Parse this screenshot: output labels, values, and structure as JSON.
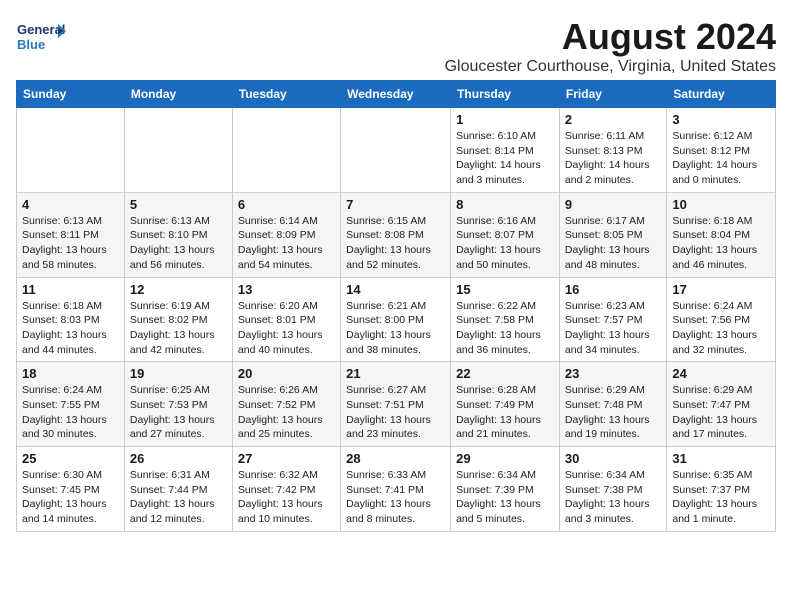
{
  "header": {
    "logo_general": "General",
    "logo_blue": "Blue",
    "title": "August 2024",
    "subtitle": "Gloucester Courthouse, Virginia, United States"
  },
  "days_of_week": [
    "Sunday",
    "Monday",
    "Tuesday",
    "Wednesday",
    "Thursday",
    "Friday",
    "Saturday"
  ],
  "weeks": [
    [
      {
        "day": "",
        "info": ""
      },
      {
        "day": "",
        "info": ""
      },
      {
        "day": "",
        "info": ""
      },
      {
        "day": "",
        "info": ""
      },
      {
        "day": "1",
        "info": "Sunrise: 6:10 AM\nSunset: 8:14 PM\nDaylight: 14 hours\nand 3 minutes."
      },
      {
        "day": "2",
        "info": "Sunrise: 6:11 AM\nSunset: 8:13 PM\nDaylight: 14 hours\nand 2 minutes."
      },
      {
        "day": "3",
        "info": "Sunrise: 6:12 AM\nSunset: 8:12 PM\nDaylight: 14 hours\nand 0 minutes."
      }
    ],
    [
      {
        "day": "4",
        "info": "Sunrise: 6:13 AM\nSunset: 8:11 PM\nDaylight: 13 hours\nand 58 minutes."
      },
      {
        "day": "5",
        "info": "Sunrise: 6:13 AM\nSunset: 8:10 PM\nDaylight: 13 hours\nand 56 minutes."
      },
      {
        "day": "6",
        "info": "Sunrise: 6:14 AM\nSunset: 8:09 PM\nDaylight: 13 hours\nand 54 minutes."
      },
      {
        "day": "7",
        "info": "Sunrise: 6:15 AM\nSunset: 8:08 PM\nDaylight: 13 hours\nand 52 minutes."
      },
      {
        "day": "8",
        "info": "Sunrise: 6:16 AM\nSunset: 8:07 PM\nDaylight: 13 hours\nand 50 minutes."
      },
      {
        "day": "9",
        "info": "Sunrise: 6:17 AM\nSunset: 8:05 PM\nDaylight: 13 hours\nand 48 minutes."
      },
      {
        "day": "10",
        "info": "Sunrise: 6:18 AM\nSunset: 8:04 PM\nDaylight: 13 hours\nand 46 minutes."
      }
    ],
    [
      {
        "day": "11",
        "info": "Sunrise: 6:18 AM\nSunset: 8:03 PM\nDaylight: 13 hours\nand 44 minutes."
      },
      {
        "day": "12",
        "info": "Sunrise: 6:19 AM\nSunset: 8:02 PM\nDaylight: 13 hours\nand 42 minutes."
      },
      {
        "day": "13",
        "info": "Sunrise: 6:20 AM\nSunset: 8:01 PM\nDaylight: 13 hours\nand 40 minutes."
      },
      {
        "day": "14",
        "info": "Sunrise: 6:21 AM\nSunset: 8:00 PM\nDaylight: 13 hours\nand 38 minutes."
      },
      {
        "day": "15",
        "info": "Sunrise: 6:22 AM\nSunset: 7:58 PM\nDaylight: 13 hours\nand 36 minutes."
      },
      {
        "day": "16",
        "info": "Sunrise: 6:23 AM\nSunset: 7:57 PM\nDaylight: 13 hours\nand 34 minutes."
      },
      {
        "day": "17",
        "info": "Sunrise: 6:24 AM\nSunset: 7:56 PM\nDaylight: 13 hours\nand 32 minutes."
      }
    ],
    [
      {
        "day": "18",
        "info": "Sunrise: 6:24 AM\nSunset: 7:55 PM\nDaylight: 13 hours\nand 30 minutes."
      },
      {
        "day": "19",
        "info": "Sunrise: 6:25 AM\nSunset: 7:53 PM\nDaylight: 13 hours\nand 27 minutes."
      },
      {
        "day": "20",
        "info": "Sunrise: 6:26 AM\nSunset: 7:52 PM\nDaylight: 13 hours\nand 25 minutes."
      },
      {
        "day": "21",
        "info": "Sunrise: 6:27 AM\nSunset: 7:51 PM\nDaylight: 13 hours\nand 23 minutes."
      },
      {
        "day": "22",
        "info": "Sunrise: 6:28 AM\nSunset: 7:49 PM\nDaylight: 13 hours\nand 21 minutes."
      },
      {
        "day": "23",
        "info": "Sunrise: 6:29 AM\nSunset: 7:48 PM\nDaylight: 13 hours\nand 19 minutes."
      },
      {
        "day": "24",
        "info": "Sunrise: 6:29 AM\nSunset: 7:47 PM\nDaylight: 13 hours\nand 17 minutes."
      }
    ],
    [
      {
        "day": "25",
        "info": "Sunrise: 6:30 AM\nSunset: 7:45 PM\nDaylight: 13 hours\nand 14 minutes."
      },
      {
        "day": "26",
        "info": "Sunrise: 6:31 AM\nSunset: 7:44 PM\nDaylight: 13 hours\nand 12 minutes."
      },
      {
        "day": "27",
        "info": "Sunrise: 6:32 AM\nSunset: 7:42 PM\nDaylight: 13 hours\nand 10 minutes."
      },
      {
        "day": "28",
        "info": "Sunrise: 6:33 AM\nSunset: 7:41 PM\nDaylight: 13 hours\nand 8 minutes."
      },
      {
        "day": "29",
        "info": "Sunrise: 6:34 AM\nSunset: 7:39 PM\nDaylight: 13 hours\nand 5 minutes."
      },
      {
        "day": "30",
        "info": "Sunrise: 6:34 AM\nSunset: 7:38 PM\nDaylight: 13 hours\nand 3 minutes."
      },
      {
        "day": "31",
        "info": "Sunrise: 6:35 AM\nSunset: 7:37 PM\nDaylight: 13 hours\nand 1 minute."
      }
    ]
  ]
}
